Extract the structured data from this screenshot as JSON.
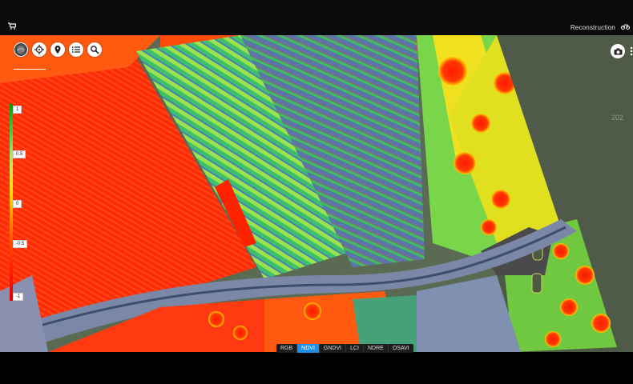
{
  "header": {
    "title": "Reconstruction",
    "cart_icon": "cart-icon",
    "bike_icon": "bike-icon"
  },
  "toolbar": {
    "tools": [
      {
        "name": "layers-icon",
        "active": true
      },
      {
        "name": "crosshair-icon",
        "active": false
      },
      {
        "name": "map-pin-icon",
        "active": false
      },
      {
        "name": "list-icon",
        "active": false
      },
      {
        "name": "search-icon",
        "active": false
      }
    ]
  },
  "right_controls": {
    "camera_icon": "camera-icon",
    "more_icon": "more-vertical-icon"
  },
  "legend": {
    "ticks": [
      "1",
      "0.5",
      "0",
      "-0.5",
      "-1"
    ]
  },
  "bands": {
    "items": [
      "RGB",
      "NDVI",
      "GNDVI",
      "LCI",
      "NDRE",
      "OSAVI"
    ],
    "active": "NDVI"
  },
  "watermark": "202"
}
